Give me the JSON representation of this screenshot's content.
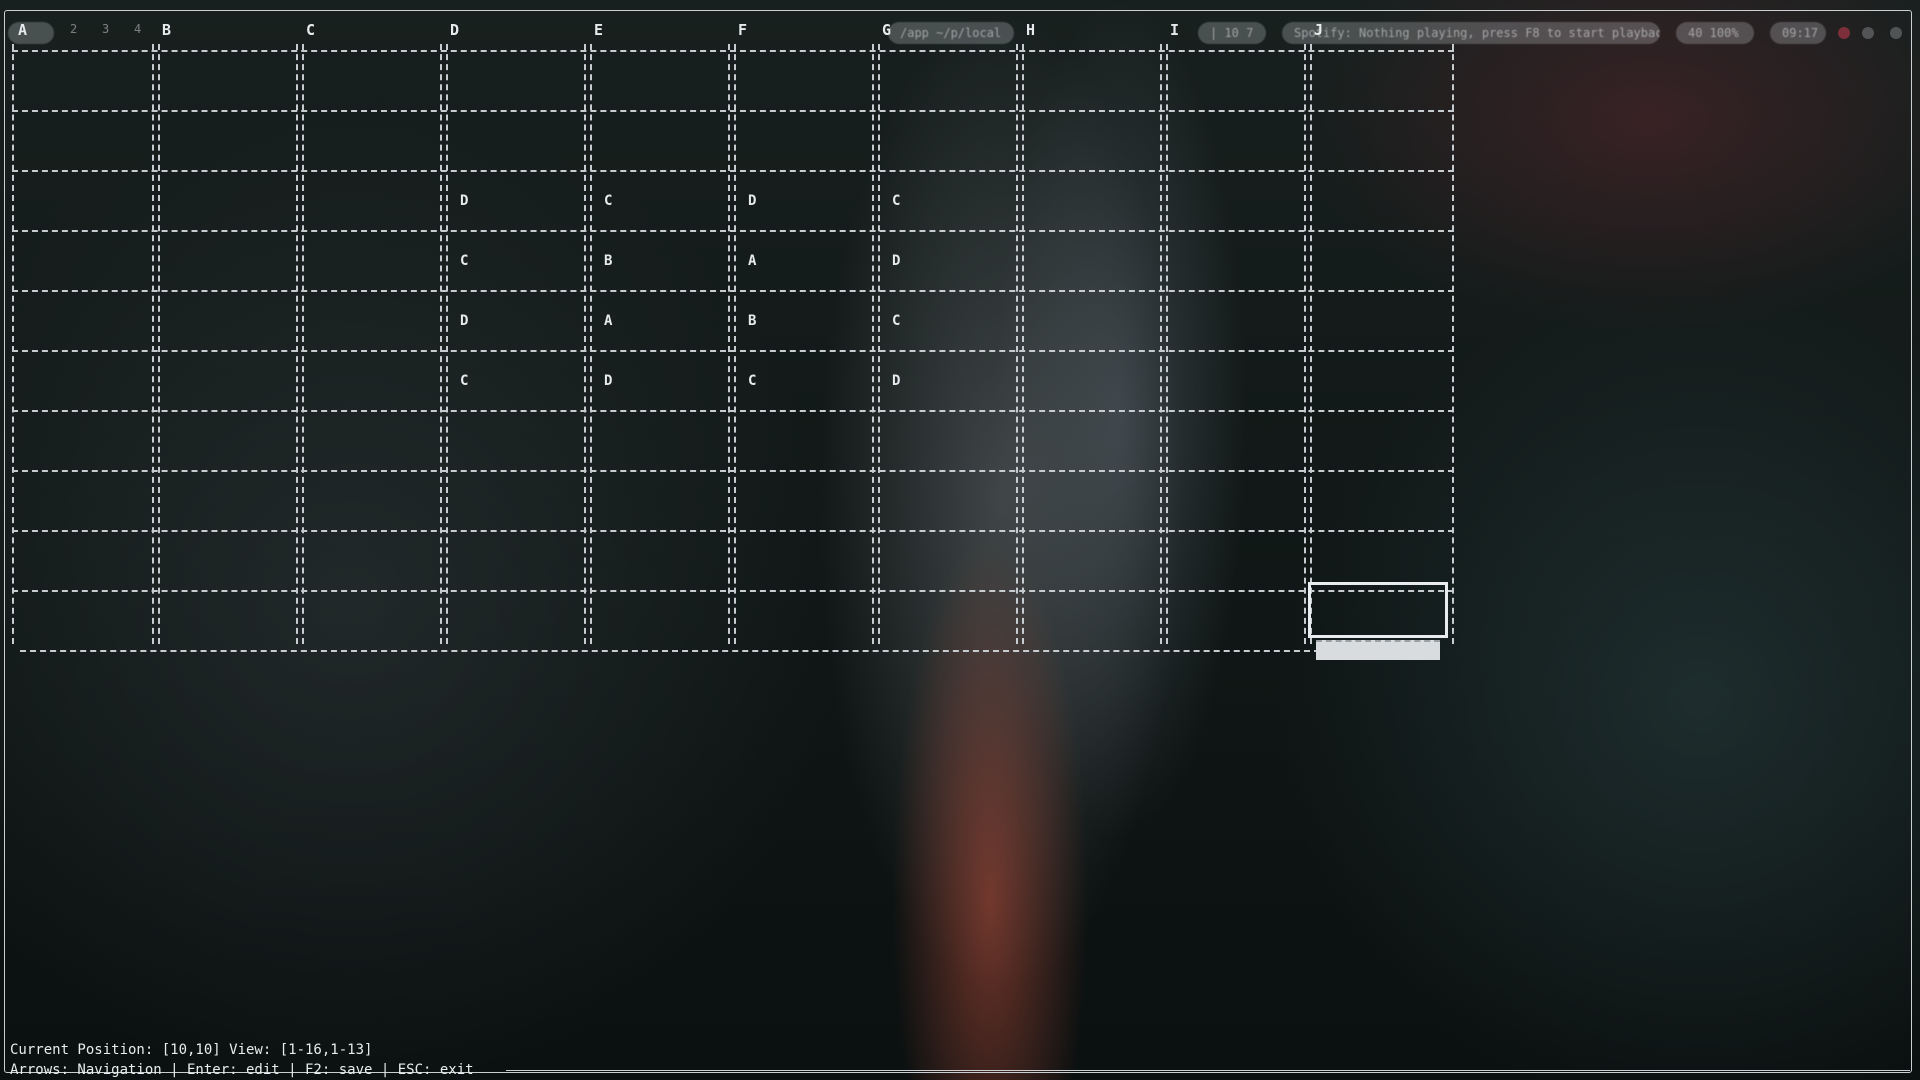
{
  "topbar": {
    "workspaces": [
      "1",
      "2",
      "3",
      "4"
    ],
    "path_pill": "/app ~/p/local",
    "counter_pill": "| 10 7",
    "notification_pill": "Spotify: Nothing playing, press F8 to start playback",
    "volume_pill": "40 100%",
    "clock_pill": "09:17"
  },
  "spreadsheet": {
    "columns": [
      "A",
      "B",
      "C",
      "D",
      "E",
      "F",
      "G",
      "H",
      "I",
      "J"
    ],
    "rows": [
      [
        "",
        "",
        "",
        "",
        "",
        "",
        "",
        "",
        "",
        ""
      ],
      [
        "",
        "",
        "",
        "",
        "",
        "",
        "",
        "",
        "",
        ""
      ],
      [
        "",
        "",
        "",
        "D",
        "C",
        "D",
        "C",
        "",
        "",
        ""
      ],
      [
        "",
        "",
        "",
        "C",
        "B",
        "A",
        "D",
        "",
        "",
        ""
      ],
      [
        "",
        "",
        "",
        "D",
        "A",
        "B",
        "C",
        "",
        "",
        ""
      ],
      [
        "",
        "",
        "",
        "C",
        "D",
        "C",
        "D",
        "",
        "",
        ""
      ],
      [
        "",
        "",
        "",
        "",
        "",
        "",
        "",
        "",
        "",
        ""
      ],
      [
        "",
        "",
        "",
        "",
        "",
        "",
        "",
        "",
        "",
        ""
      ],
      [
        "",
        "",
        "",
        "",
        "",
        "",
        "",
        "",
        "",
        ""
      ],
      [
        "",
        "",
        "",
        "",
        "",
        "",
        "",
        "",
        "",
        ""
      ]
    ],
    "selected_row": 9,
    "selected_col": 9
  },
  "status": {
    "position_line": "Current Position: [10,10] View: [1-16,1-13]",
    "help_line": "Arrows: Navigation | Enter: edit | F2: save | ESC: exit"
  }
}
